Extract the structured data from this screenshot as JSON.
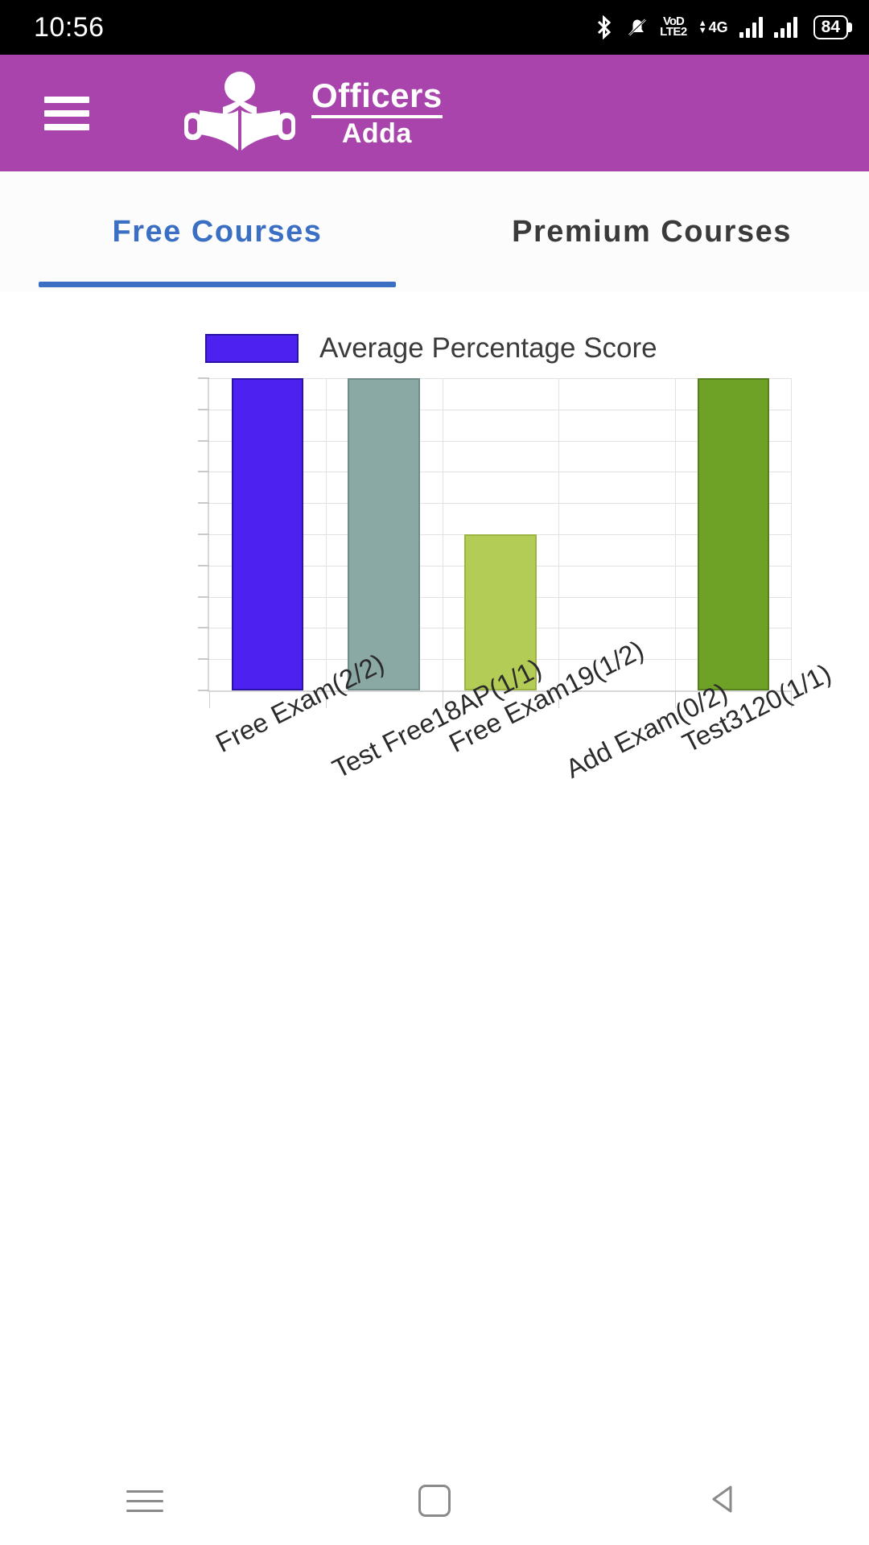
{
  "status_bar": {
    "time": "10:56",
    "icons": [
      {
        "name": "bluetooth-icon",
        "label": "Bluetooth"
      },
      {
        "name": "notifications-silenced-icon",
        "label": "Silent"
      },
      {
        "name": "volte-icon",
        "line1": "VoD",
        "line2": "LTE2"
      },
      {
        "name": "mobile-data-4g-icon",
        "label": "4G"
      },
      {
        "name": "signal-bars-sim1-icon",
        "label": "Signal 1"
      },
      {
        "name": "signal-bars-sim2-icon",
        "label": "Signal 2"
      }
    ],
    "battery_percent": "84"
  },
  "app_bar": {
    "menu_label": "Menu",
    "logo_line1": "Officers",
    "logo_line2": "Adda",
    "background_color": "#a844ab"
  },
  "tabs": [
    {
      "label": "Free Courses",
      "active": true
    },
    {
      "label": "Premium Courses",
      "active": false
    }
  ],
  "accent_color": "#3b6fc4",
  "chart_data": {
    "type": "bar",
    "title": "",
    "xlabel": "",
    "ylabel": "",
    "ylim": [
      0,
      100
    ],
    "yticks": [
      0,
      10,
      20,
      30,
      40,
      50,
      60,
      70,
      80,
      90,
      100
    ],
    "grid": true,
    "legend_position": "top",
    "legend": [
      "Average Percentage Score"
    ],
    "legend_swatch_color": "#4d21f0",
    "categories": [
      "Free Exam(2/2)",
      "Test Free18AP(1/1)",
      "Free Exam19(1/2)",
      "Add Exam(0/2)",
      "Test3120(1/1)"
    ],
    "values": [
      100,
      100,
      50,
      0,
      100
    ],
    "bar_colors": [
      "#4d21f0",
      "#8aa9a5",
      "#b3cc55",
      "#ffffff",
      "#6da227"
    ],
    "bar_border_colors": [
      "#2a11a8",
      "#6f8e8a",
      "#9ab341",
      "#ffffff",
      "#55801c"
    ],
    "series": [
      {
        "name": "Average Percentage Score",
        "values": [
          100,
          100,
          50,
          0,
          100
        ]
      }
    ]
  },
  "nav_bar": {
    "recents_label": "Recents",
    "home_label": "Home",
    "back_label": "Back"
  }
}
